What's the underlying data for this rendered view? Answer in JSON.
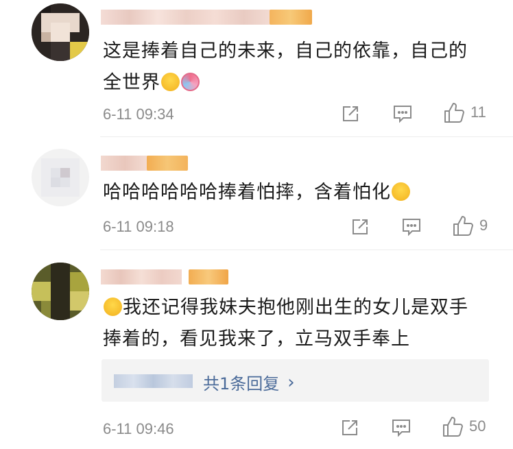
{
  "comments": [
    {
      "text_line1": "这是捧着自己的未来，自己的依靠，自己的",
      "text_line2": "全世界",
      "emojis": [
        "scream-emoji",
        "lollipop-emoji"
      ],
      "time": "6-11 09:34",
      "likes": "11"
    },
    {
      "text_line1": "哈哈哈哈哈哈捧着怕摔，含着怕化",
      "emojis": [
        "laugh-tears-emoji"
      ],
      "time": "6-11 09:18",
      "likes": "9"
    },
    {
      "text_line1": "我还记得我妹夫抱他刚出生的女儿是双手",
      "text_line2": "捧着的，看见我来了，立马双手奉上",
      "emojis": [
        "laugh-emoji"
      ],
      "time": "6-11 09:46",
      "likes": "50",
      "reply_link": "共1条回复",
      "reply_chevron": "›"
    }
  ],
  "colors": {
    "link": "#4a6a99",
    "meta": "#8a8a8a",
    "reply_bg": "#f3f3f3"
  }
}
